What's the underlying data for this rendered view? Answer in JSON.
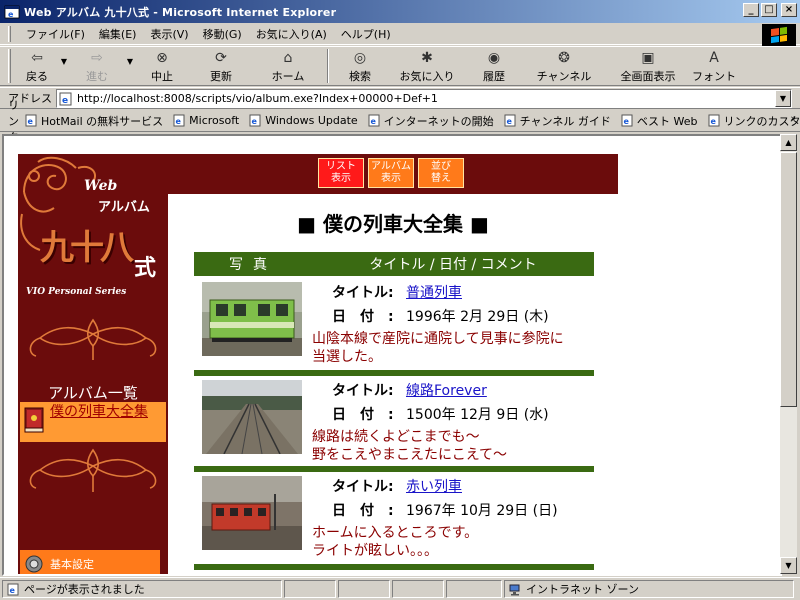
{
  "window": {
    "title": "Web アルバム 九十八式 - Microsoft Internet Explorer",
    "buttons": [
      "_",
      "□",
      "×"
    ]
  },
  "menu": [
    "ファイル(F)",
    "編集(E)",
    "表示(V)",
    "移動(G)",
    "お気に入り(A)",
    "ヘルプ(H)"
  ],
  "toolbar": {
    "back": "戻る",
    "forward": "進む",
    "stop": "中止",
    "refresh": "更新",
    "home": "ホーム",
    "search": "検索",
    "favorites": "お気に入り",
    "history": "履歴",
    "channels": "チャンネル",
    "fullscreen": "全画面表示",
    "fonts": "フォント"
  },
  "address": {
    "label": "アドレス",
    "value": "http://localhost:8008/scripts/vio/album.exe?Index+00000+Def+1"
  },
  "links": {
    "label": "リンク",
    "items": [
      "HotMail の無料サービス",
      "Microsoft",
      "Windows Update",
      "インターネットの開始",
      "チャンネル ガイド",
      "ベスト Web",
      "リンクのカスタ"
    ],
    "more": "»"
  },
  "status": {
    "text": "ページが表示されました",
    "zone": "イントラネット ゾーン"
  },
  "page": {
    "nav": [
      {
        "line1": "リスト",
        "line2": "表示"
      },
      {
        "line1": "アルバム",
        "line2": "表示"
      },
      {
        "line1": "並び",
        "line2": "替え"
      }
    ],
    "logo": {
      "web": "Web",
      "album": "アルバム",
      "kanji": "九十八",
      "shiki": "式",
      "series": "VIO Personal Series"
    },
    "album_list_title": "アルバム一覧",
    "album_entry": "僕の列車大全集",
    "settings": "基本設定",
    "title": "■ 僕の列車大全集 ■",
    "header": {
      "photo": "写真",
      "info": "タイトル / 日付 / コメント"
    },
    "labels": {
      "title": "タイトル:",
      "date": "日付:"
    },
    "entries": [
      {
        "title": "普通列車",
        "date": "1996年 2月 29日 (木)",
        "comment1": "山陰本線で産院に通院して見事に参院に",
        "comment2": "当選した。"
      },
      {
        "title": "線路Forever",
        "date": "1500年 12月 9日 (水)",
        "comment1": "線路は続くよどこまでも～",
        "comment2": "野をこえやまこえたにこえて～"
      },
      {
        "title": "赤い列車",
        "date": "1967年 10月 29日 (日)",
        "comment1": "ホームに入るところです。",
        "comment2": "ライトが眩しい。。。"
      }
    ]
  },
  "colors": {
    "sidebar": "#6b0c0c",
    "header_green": "#3a6a12",
    "nav_red": "#ff1a1a",
    "nav_orange": "#ff7a1a",
    "comment": "#8a0000",
    "link": "#1a14c8"
  }
}
